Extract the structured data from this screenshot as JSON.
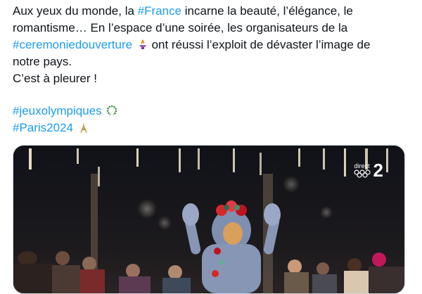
{
  "tweet": {
    "line1": {
      "pre": "Aux yeux du monde, la ",
      "hashtag": "#France",
      "post": " incarne la beauté, l’élégance, le"
    },
    "line2": "romantisme… En l’espace d’une soirée, les organisateurs de la",
    "line3": {
      "hashtag": "#ceremoniedouverture",
      "post": " ont réussi l’exploit de dévaster l’image de"
    },
    "line4": "notre pays.",
    "line5": "C’est à pleurer !",
    "hashtag_jeux": "#jeuxolympiques",
    "hashtag_paris": "#Paris2024"
  },
  "media": {
    "broadcast_label": "direct",
    "channel_number": "2"
  },
  "colors": {
    "hashtag": "#1d9bf0",
    "text": "#0f1419",
    "border": "#cfd9de"
  },
  "icons": [
    "torch-icon",
    "laurel-wreath-icon",
    "eiffel-tower-icon",
    "olympic-rings-icon"
  ]
}
